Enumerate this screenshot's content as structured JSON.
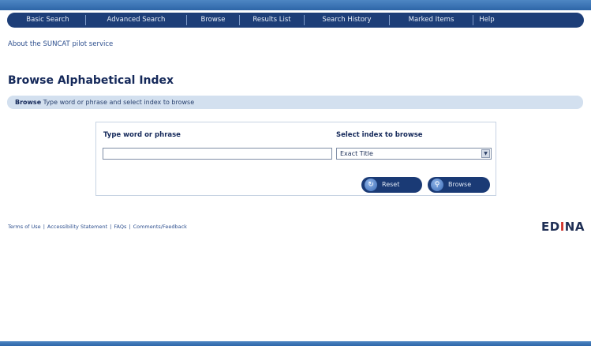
{
  "nav": {
    "items": [
      {
        "label": "Basic Search",
        "w": 96
      },
      {
        "label": "Advanced Search",
        "w": 128
      },
      {
        "label": "Browse",
        "w": 67
      },
      {
        "label": "Results List",
        "w": 82
      },
      {
        "label": "Search History",
        "w": 108
      },
      {
        "label": "Marked Items",
        "w": 106
      },
      {
        "label": "Help",
        "w": 34
      }
    ]
  },
  "about_link": "About the SUNCAT pilot service",
  "page_title": "Browse Alphabetical Index",
  "info_bar": {
    "strong": "Browse",
    "text": "Type word or phrase and select index to browse"
  },
  "form": {
    "word_label": "Type word or phrase",
    "word_value": "",
    "index_label": "Select index to browse",
    "index_selected": "Exact Title",
    "reset_label": "Reset",
    "browse_label": "Browse"
  },
  "footer": {
    "links": [
      "Terms of Use",
      "Accessibility Statement",
      "FAQs",
      "Comments/Feedback"
    ],
    "separator": "|"
  },
  "logo": {
    "pre": "ED",
    "dot": "I",
    "post": "NA"
  },
  "colors": {
    "navbar": "#1d3e78",
    "band": "#2e66a8",
    "info_bar": "#d3e0ef",
    "button": "#1a3a75"
  }
}
